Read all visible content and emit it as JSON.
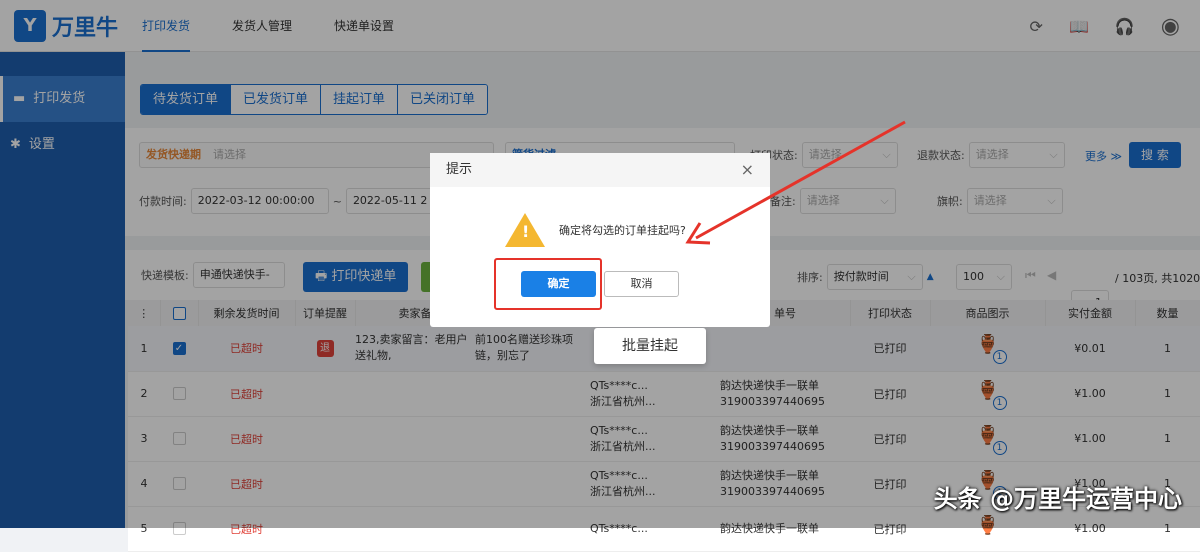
{
  "header": {
    "logo": "万里牛",
    "logo_mark": "Y",
    "nav": [
      "打印发货",
      "发货人管理",
      "快递单设置"
    ]
  },
  "sidebar": {
    "items": [
      {
        "icon": "printer-icon",
        "label": "打印发货"
      },
      {
        "icon": "gear-icon",
        "label": "设置"
      }
    ]
  },
  "tabs": [
    "待发货订单",
    "已发货订单",
    "挂起订单",
    "已关闭订单"
  ],
  "filters": {
    "express_period": "发货快递期",
    "placeholder": "请选择",
    "goods_filter": "筛货过滤",
    "print_status": "打印状态:",
    "refund_status": "退款状态:",
    "more": "更多 ≫",
    "search": "搜 索",
    "pay_time": "付款时间:",
    "start": "2022-03-12 00:00:00",
    "tilde": "~",
    "end": "2022-05-11 2",
    "remark": "备注:",
    "flag": "旗帜:"
  },
  "toolbar": {
    "template_label": "快递模板:",
    "template_value": "申通快递快手-",
    "print_button": "打印快递单",
    "sort_label": "排序:",
    "sort_value": "按付款时间",
    "page_size": "100",
    "page": "1",
    "page_info": "/ 103页, 共1020"
  },
  "table": {
    "columns": [
      "⋮",
      "",
      "剩余发货时间",
      "订单提醒",
      "卖家备",
      "",
      "",
      "单号",
      "打印状态",
      "商品图示",
      "实付金额",
      "数量"
    ],
    "rows": [
      {
        "no": "1",
        "checked": true,
        "time": "已超时",
        "remind": "退",
        "seller": "123,卖家留言：老用户送礼物,",
        "buyer": "前100名赠送珍珠项链，别忘了",
        "recv1": "",
        "recv2": "",
        "ex1": "",
        "ex2": "",
        "print": "已打印",
        "qty_badge": "1",
        "amount": "¥0.01",
        "qty": "1"
      },
      {
        "no": "2",
        "checked": false,
        "time": "已超时",
        "remind": "",
        "seller": "",
        "buyer": "",
        "recv1": "QTs****c...",
        "recv2": "浙江省杭州...",
        "ex1": "韵达快递快手一联单",
        "ex2": "319003397440695",
        "print": "已打印",
        "qty_badge": "1",
        "amount": "¥1.00",
        "qty": "1"
      },
      {
        "no": "3",
        "checked": false,
        "time": "已超时",
        "remind": "",
        "seller": "",
        "buyer": "",
        "recv1": "QTs****c...",
        "recv2": "浙江省杭州...",
        "ex1": "韵达快递快手一联单",
        "ex2": "319003397440695",
        "print": "已打印",
        "qty_badge": "1",
        "amount": "¥1.00",
        "qty": "1"
      },
      {
        "no": "4",
        "checked": false,
        "time": "已超时",
        "remind": "",
        "seller": "",
        "buyer": "",
        "recv1": "QTs****c...",
        "recv2": "浙江省杭州...",
        "ex1": "韵达快递快手一联单",
        "ex2": "319003397440695",
        "print": "已打印",
        "qty_badge": "1",
        "amount": "¥1.00",
        "qty": "1"
      },
      {
        "no": "5",
        "checked": false,
        "time": "已超时",
        "remind": "",
        "seller": "",
        "buyer": "",
        "recv1": "QTs****c...",
        "recv2": "",
        "ex1": "韵达快递快手一联单",
        "ex2": "",
        "print": "已打印",
        "qty_badge": "",
        "amount": "¥1.00",
        "qty": "1"
      }
    ]
  },
  "popup": {
    "batch_suspend": "批量挂起"
  },
  "modal": {
    "title": "提示",
    "message": "确定将勾选的订单挂起吗?",
    "ok": "确定",
    "cancel": "取消",
    "close": "×"
  },
  "watermark": "头条 @万里牛运营中心",
  "colors": {
    "primary": "#1a6fd1",
    "danger": "#e0433a",
    "annotation": "#e5332a",
    "warning": "#f4b731"
  }
}
